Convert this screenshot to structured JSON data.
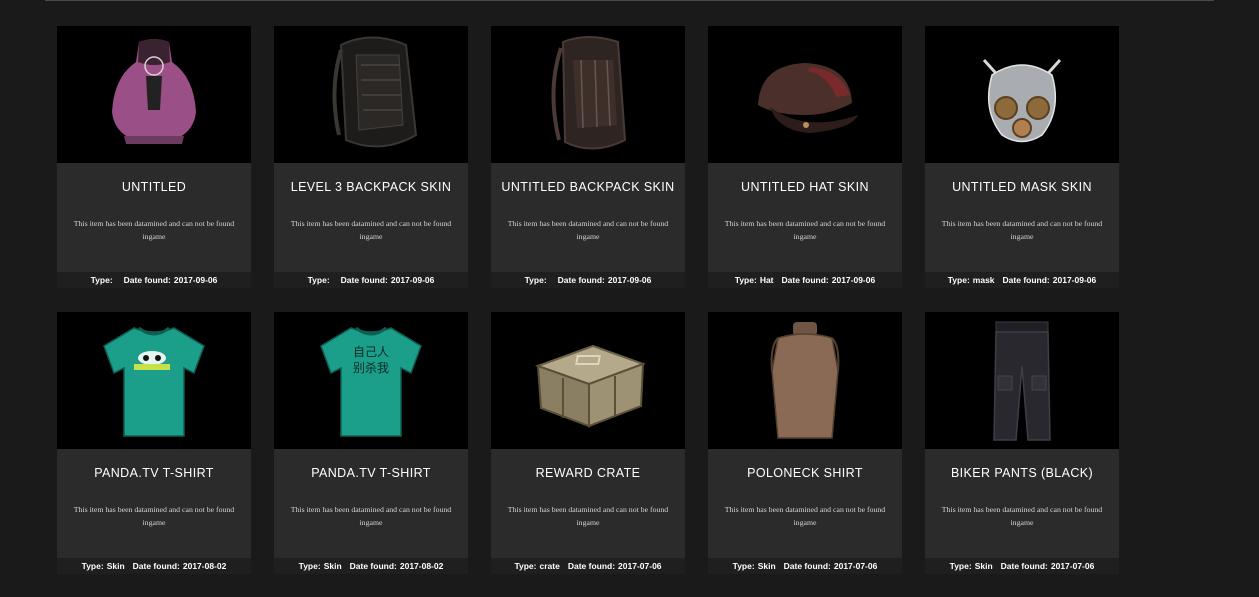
{
  "items": [
    {
      "name": "UNTITLED",
      "description": "This item has been datamined and can not be found ingame",
      "type_label": "Type:",
      "type_value": "",
      "date_label": "Date found:",
      "date_value": "2017-09-06",
      "icon": "crop-top-icon"
    },
    {
      "name": "LEVEL 3 BACKPACK SKIN",
      "description": "This item has been datamined and can not be found ingame",
      "type_label": "Type:",
      "type_value": "",
      "date_label": "Date found:",
      "date_value": "2017-09-06",
      "icon": "backpack-icon"
    },
    {
      "name": "UNTITLED BACKPACK SKIN",
      "description": "This item has been datamined and can not be found ingame",
      "type_label": "Type:",
      "type_value": "",
      "date_label": "Date found:",
      "date_value": "2017-09-06",
      "icon": "backpack-icon"
    },
    {
      "name": "UNTITLED HAT SKIN",
      "description": "This item has been datamined and can not be found ingame",
      "type_label": "Type:",
      "type_value": "Hat",
      "date_label": "Date found:",
      "date_value": "2017-09-06",
      "icon": "hat-icon"
    },
    {
      "name": "UNTITLED MASK SKIN",
      "description": "This item has been datamined and can not be found ingame",
      "type_label": "Type:",
      "type_value": "mask",
      "date_label": "Date found:",
      "date_value": "2017-09-06",
      "icon": "gas-mask-icon"
    },
    {
      "name": "PANDA.TV T-SHIRT",
      "description": "This item has been datamined and can not be found ingame",
      "type_label": "Type:",
      "type_value": "Skin",
      "date_label": "Date found:",
      "date_value": "2017-08-02",
      "icon": "tshirt-icon"
    },
    {
      "name": "PANDA.TV T-SHIRT",
      "description": "This item has been datamined and can not be found ingame",
      "type_label": "Type:",
      "type_value": "Skin",
      "date_label": "Date found:",
      "date_value": "2017-08-02",
      "icon": "tshirt-icon"
    },
    {
      "name": "REWARD CRATE",
      "description": "This item has been datamined and can not be found ingame",
      "type_label": "Type:",
      "type_value": "crate",
      "date_label": "Date found:",
      "date_value": "2017-07-06",
      "icon": "crate-icon"
    },
    {
      "name": "POLONECK SHIRT",
      "description": "This item has been datamined and can not be found ingame",
      "type_label": "Type:",
      "type_value": "Skin",
      "date_label": "Date found:",
      "date_value": "2017-07-06",
      "icon": "poloneck-icon"
    },
    {
      "name": "BIKER PANTS (BLACK)",
      "description": "This item has been datamined and can not be found ingame",
      "type_label": "Type:",
      "type_value": "Skin",
      "date_label": "Date found:",
      "date_value": "2017-07-06",
      "icon": "pants-icon"
    }
  ],
  "tshirt_prints": [
    "",
    "自己人\n别杀我"
  ],
  "colors": {
    "page_bg": "#1a1a1a",
    "card_bg": "#2b2b2b",
    "image_bg": "#000000",
    "meta_bg": "#1f1f1f",
    "title_text": "#ffffff",
    "tshirt_teal": "#1b9e8a",
    "crop_top_purple": "#9a4f86",
    "vest_brown": "#8a6a55"
  }
}
